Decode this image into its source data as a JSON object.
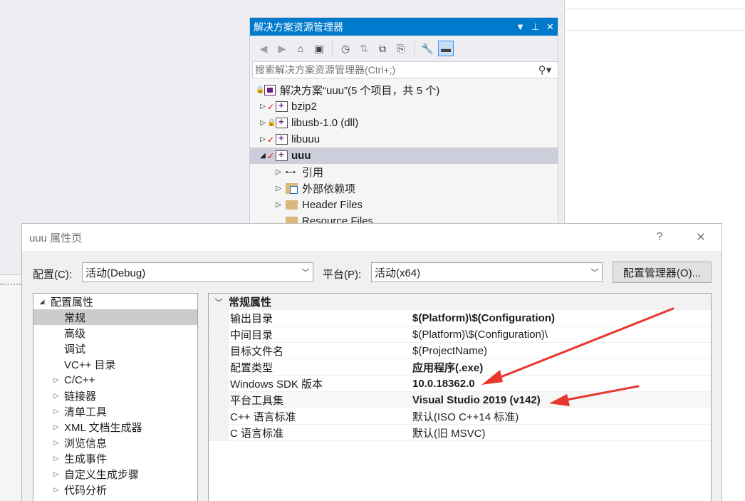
{
  "solution_explorer": {
    "title": "解决方案资源管理器",
    "title_buttons": [
      "▼",
      "⊥",
      "✕"
    ],
    "search_placeholder": "搜索解决方案资源管理器(Ctrl+;)",
    "tree": [
      {
        "label": "解决方案“uuu”(5 个项目，共 5 个)",
        "type": "solution"
      },
      {
        "label": "bzip2",
        "type": "project",
        "status": "check"
      },
      {
        "label": "libusb-1.0 (dll)",
        "type": "project",
        "status": "lock"
      },
      {
        "label": "libuuu",
        "type": "project",
        "status": "check"
      },
      {
        "label": "uuu",
        "type": "project",
        "status": "check",
        "selected": true,
        "expanded": true
      },
      {
        "label": "引用",
        "type": "references"
      },
      {
        "label": "外部依赖项",
        "type": "external"
      },
      {
        "label": "Header Files",
        "type": "folder"
      },
      {
        "label": "Resource Files",
        "type": "folder"
      }
    ]
  },
  "dialog": {
    "title": "uuu 属性页",
    "help": "?",
    "close": "✕",
    "config_label": "配置(C):",
    "config_value": "活动(Debug)",
    "platform_label": "平台(P):",
    "platform_value": "活动(x64)",
    "config_manager": "配置管理器(O)...",
    "nav": [
      {
        "label": "配置属性",
        "level": 0,
        "arrow": "◢"
      },
      {
        "label": "常规",
        "level": 1,
        "selected": true
      },
      {
        "label": "高级",
        "level": 1
      },
      {
        "label": "调试",
        "level": 1
      },
      {
        "label": "VC++ 目录",
        "level": 1
      },
      {
        "label": "C/C++",
        "level": 1,
        "arrow": "▷"
      },
      {
        "label": "链接器",
        "level": 1,
        "arrow": "▷"
      },
      {
        "label": "清单工具",
        "level": 1,
        "arrow": "▷"
      },
      {
        "label": "XML 文档生成器",
        "level": 1,
        "arrow": "▷"
      },
      {
        "label": "浏览信息",
        "level": 1,
        "arrow": "▷"
      },
      {
        "label": "生成事件",
        "level": 1,
        "arrow": "▷"
      },
      {
        "label": "自定义生成步骤",
        "level": 1,
        "arrow": "▷"
      },
      {
        "label": "代码分析",
        "level": 1,
        "arrow": "▷"
      }
    ],
    "category": "常规属性",
    "properties": [
      {
        "name": "输出目录",
        "value": "$(Platform)\\$(Configuration)",
        "bold": true
      },
      {
        "name": "中间目录",
        "value": "$(Platform)\\$(Configuration)\\",
        "bold": false
      },
      {
        "name": "目标文件名",
        "value": "$(ProjectName)",
        "bold": false
      },
      {
        "name": "配置类型",
        "value": "应用程序(.exe)",
        "bold": true
      },
      {
        "name": "Windows SDK 版本",
        "value": "10.0.18362.0",
        "bold": true
      },
      {
        "name": "平台工具集",
        "value": "Visual Studio 2019 (v142)",
        "bold": true
      },
      {
        "name": "C++ 语言标准",
        "value": "默认(ISO C++14 标准)",
        "bold": false
      },
      {
        "name": "C 语言标准",
        "value": "默认(旧 MSVC)",
        "bold": false
      }
    ]
  },
  "colors": {
    "accent": "#007acc",
    "annotation_arrow": "#e8372c"
  }
}
